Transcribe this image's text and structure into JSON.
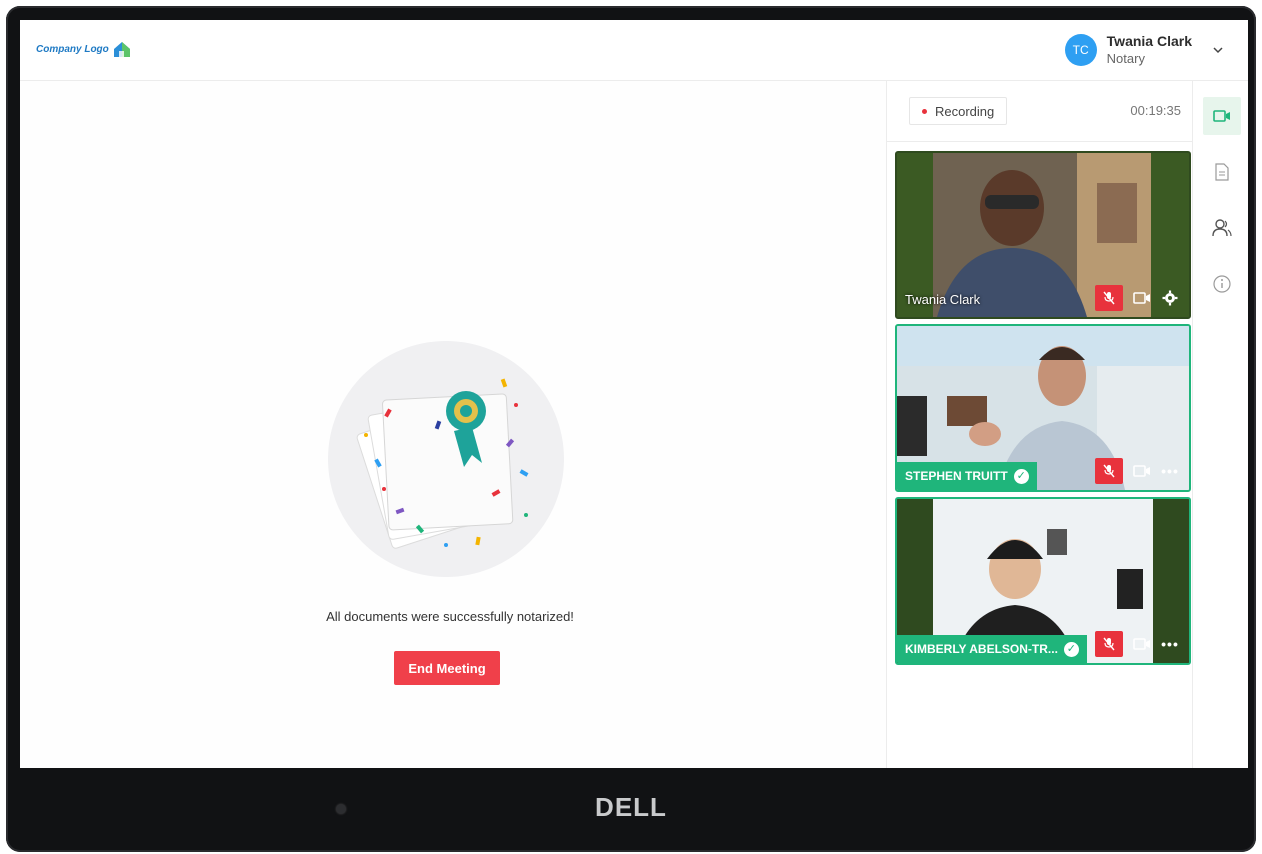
{
  "header": {
    "logo_text": "Company Logo",
    "user": {
      "initials": "TC",
      "name": "Twania Clark",
      "role": "Notary"
    }
  },
  "main": {
    "success_message": "All documents were successfully notarized!",
    "end_meeting_label": "End Meeting"
  },
  "panel": {
    "recording_label": "Recording",
    "timer": "00:19:35",
    "participants": [
      {
        "name": "Twania Clark",
        "verified": false
      },
      {
        "name": "STEPHEN TRUITT",
        "verified": true
      },
      {
        "name": "KIMBERLY ABELSON-TR...",
        "verified": true
      }
    ]
  },
  "rail": {
    "items": [
      {
        "icon": "video-camera-icon",
        "active": true
      },
      {
        "icon": "document-icon",
        "active": false
      },
      {
        "icon": "participants-icon",
        "active": false
      },
      {
        "icon": "info-icon",
        "active": false
      }
    ]
  },
  "device": {
    "brand": "DELL"
  },
  "colors": {
    "accent_green": "#1fb57b",
    "danger_red": "#f0404a",
    "avatar_blue": "#2e9ff2"
  }
}
